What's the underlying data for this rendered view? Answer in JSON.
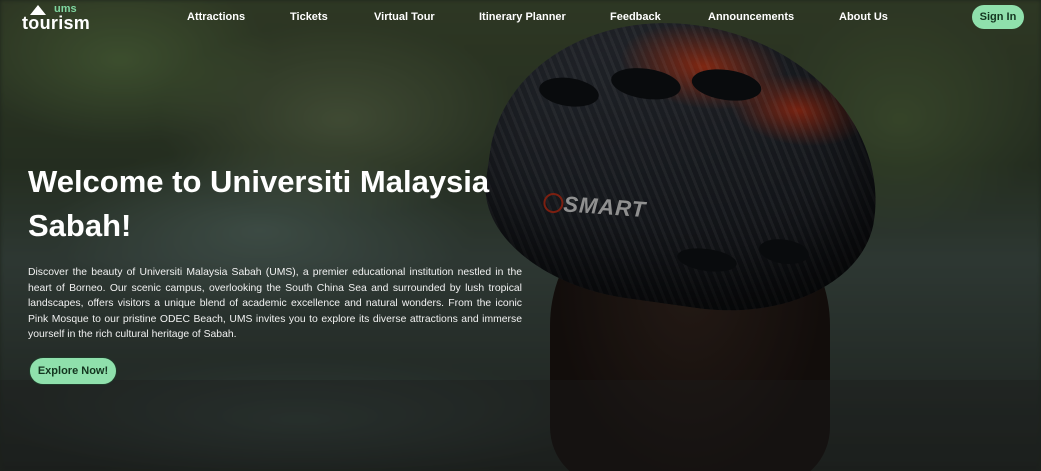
{
  "logo": {
    "top_text": "ums",
    "main_text": "tourism",
    "icon": "mountain-icon"
  },
  "nav": {
    "items": [
      {
        "label": "Attractions"
      },
      {
        "label": "Tickets"
      },
      {
        "label": "Virtual Tour"
      },
      {
        "label": "Itinerary Planner"
      },
      {
        "label": "Feedback"
      },
      {
        "label": "Announcements"
      },
      {
        "label": "About Us"
      }
    ],
    "signin_label": "Sign In"
  },
  "hero": {
    "title": "Welcome to Universiti Malaysia Sabah!",
    "description": "Discover the beauty of Universiti Malaysia Sabah (UMS), a premier educational institution nestled in the heart of Borneo. Our scenic campus, overlooking the South China Sea and surrounded by lush tropical landscapes, offers visitors a unique blend of academic excellence and natural wonders. From the iconic Pink Mosque to our pristine ODEC Beach, UMS invites you to explore its diverse attractions and immerse yourself in the rich cultural heritage of Sabah.",
    "cta_label": "Explore Now!",
    "helmet_text": "SMART"
  },
  "colors": {
    "accent": "#8fe0ac",
    "accent_text": "#13351f"
  }
}
